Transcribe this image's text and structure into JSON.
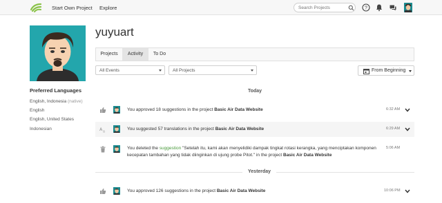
{
  "nav": {
    "start_project": "Start Own Project",
    "explore": "Explore",
    "search_placeholder": "Search Projects"
  },
  "profile": {
    "username": "yuyuart",
    "languages_title": "Preferred Languages",
    "languages": [
      {
        "name": "English, Indonesia",
        "note": "(native)"
      },
      {
        "name": "English",
        "note": ""
      },
      {
        "name": "English, United States",
        "note": ""
      },
      {
        "name": "Indonesian",
        "note": ""
      }
    ]
  },
  "tabs": [
    "Projects",
    "Activity",
    "To Do"
  ],
  "active_tab": "Activity",
  "filters": {
    "events": "All Events",
    "projects": "All Projects",
    "from": "From Beginning"
  },
  "activity": {
    "today": "Today",
    "yesterday": "Yesterday",
    "rows": [
      {
        "prefix": "You approved 18 suggestions in the project ",
        "project": "Basic Air Data Website",
        "time": "6:32 AM"
      },
      {
        "prefix": "You suggested 57 translations in the project ",
        "project": "Basic Air Data Website",
        "time": "6:29 AM"
      },
      {
        "prefix": "You deleted the ",
        "link": "suggestion",
        "quote1": " \"Setelah itu, kami akan menyelidiki dampak tingkat rotasi kerangka, yang menciptakan komponen",
        "quote2": "kecepatan tambahan yang tidak diinginkan di ujung probe Pitot.\" in the project ",
        "project": "Basic Air Data Website",
        "time": "5:06 AM"
      },
      {
        "prefix": "You approved 126 suggestions in the project ",
        "project": "Basic Air Data Website",
        "time": "10:06 PM"
      }
    ]
  },
  "colors": {
    "accent": "#23a6ac",
    "link": "#4a9a3c",
    "logo": "#8bc34a"
  }
}
